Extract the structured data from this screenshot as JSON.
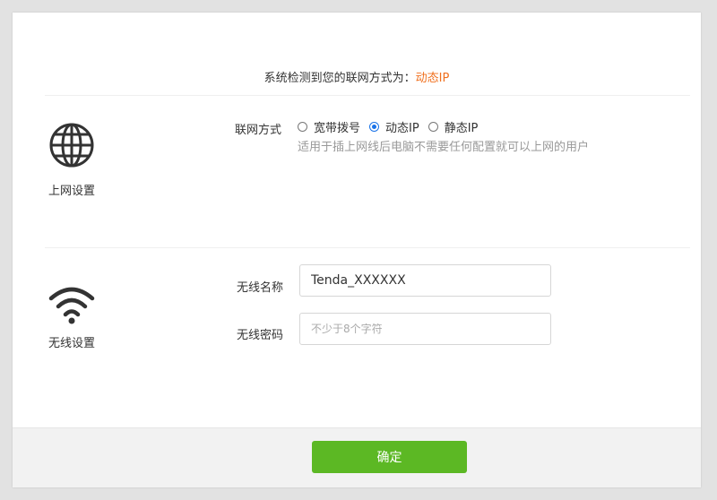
{
  "detect": {
    "prefix": "系统检测到您的联网方式为：",
    "value": "动态IP",
    "accent_color": "#f0701e"
  },
  "internet": {
    "section_label": "上网设置",
    "icon": "globe-icon",
    "mode_label": "联网方式",
    "options": [
      {
        "label": "宽带拨号",
        "checked": false
      },
      {
        "label": "动态IP",
        "checked": true
      },
      {
        "label": "静态IP",
        "checked": false
      }
    ],
    "hint": "适用于插上网线后电脑不需要任何配置就可以上网的用户"
  },
  "wireless": {
    "section_label": "无线设置",
    "icon": "wifi-icon",
    "ssid_label": "无线名称",
    "ssid_value": "Tenda_XXXXXX",
    "password_label": "无线密码",
    "password_placeholder": "不少于8个字符"
  },
  "footer": {
    "confirm_label": "确定",
    "confirm_color": "#5cb824"
  }
}
